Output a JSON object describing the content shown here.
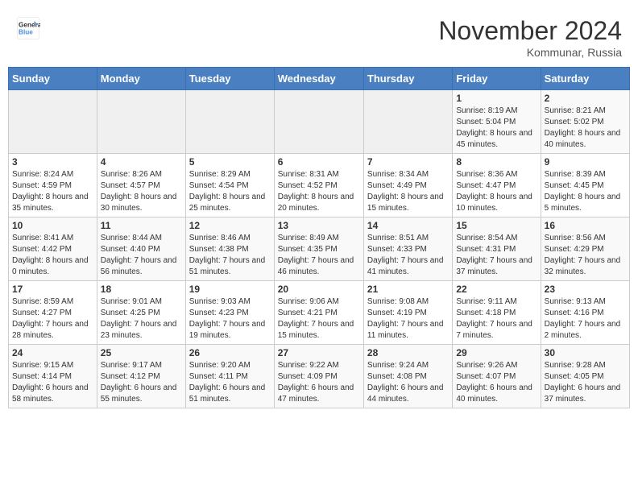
{
  "logo": {
    "line1": "General",
    "line2": "Blue"
  },
  "title": "November 2024",
  "location": "Kommunar, Russia",
  "weekdays": [
    "Sunday",
    "Monday",
    "Tuesday",
    "Wednesday",
    "Thursday",
    "Friday",
    "Saturday"
  ],
  "weeks": [
    [
      {
        "day": "",
        "info": ""
      },
      {
        "day": "",
        "info": ""
      },
      {
        "day": "",
        "info": ""
      },
      {
        "day": "",
        "info": ""
      },
      {
        "day": "",
        "info": ""
      },
      {
        "day": "1",
        "info": "Sunrise: 8:19 AM\nSunset: 5:04 PM\nDaylight: 8 hours and 45 minutes."
      },
      {
        "day": "2",
        "info": "Sunrise: 8:21 AM\nSunset: 5:02 PM\nDaylight: 8 hours and 40 minutes."
      }
    ],
    [
      {
        "day": "3",
        "info": "Sunrise: 8:24 AM\nSunset: 4:59 PM\nDaylight: 8 hours and 35 minutes."
      },
      {
        "day": "4",
        "info": "Sunrise: 8:26 AM\nSunset: 4:57 PM\nDaylight: 8 hours and 30 minutes."
      },
      {
        "day": "5",
        "info": "Sunrise: 8:29 AM\nSunset: 4:54 PM\nDaylight: 8 hours and 25 minutes."
      },
      {
        "day": "6",
        "info": "Sunrise: 8:31 AM\nSunset: 4:52 PM\nDaylight: 8 hours and 20 minutes."
      },
      {
        "day": "7",
        "info": "Sunrise: 8:34 AM\nSunset: 4:49 PM\nDaylight: 8 hours and 15 minutes."
      },
      {
        "day": "8",
        "info": "Sunrise: 8:36 AM\nSunset: 4:47 PM\nDaylight: 8 hours and 10 minutes."
      },
      {
        "day": "9",
        "info": "Sunrise: 8:39 AM\nSunset: 4:45 PM\nDaylight: 8 hours and 5 minutes."
      }
    ],
    [
      {
        "day": "10",
        "info": "Sunrise: 8:41 AM\nSunset: 4:42 PM\nDaylight: 8 hours and 0 minutes."
      },
      {
        "day": "11",
        "info": "Sunrise: 8:44 AM\nSunset: 4:40 PM\nDaylight: 7 hours and 56 minutes."
      },
      {
        "day": "12",
        "info": "Sunrise: 8:46 AM\nSunset: 4:38 PM\nDaylight: 7 hours and 51 minutes."
      },
      {
        "day": "13",
        "info": "Sunrise: 8:49 AM\nSunset: 4:35 PM\nDaylight: 7 hours and 46 minutes."
      },
      {
        "day": "14",
        "info": "Sunrise: 8:51 AM\nSunset: 4:33 PM\nDaylight: 7 hours and 41 minutes."
      },
      {
        "day": "15",
        "info": "Sunrise: 8:54 AM\nSunset: 4:31 PM\nDaylight: 7 hours and 37 minutes."
      },
      {
        "day": "16",
        "info": "Sunrise: 8:56 AM\nSunset: 4:29 PM\nDaylight: 7 hours and 32 minutes."
      }
    ],
    [
      {
        "day": "17",
        "info": "Sunrise: 8:59 AM\nSunset: 4:27 PM\nDaylight: 7 hours and 28 minutes."
      },
      {
        "day": "18",
        "info": "Sunrise: 9:01 AM\nSunset: 4:25 PM\nDaylight: 7 hours and 23 minutes."
      },
      {
        "day": "19",
        "info": "Sunrise: 9:03 AM\nSunset: 4:23 PM\nDaylight: 7 hours and 19 minutes."
      },
      {
        "day": "20",
        "info": "Sunrise: 9:06 AM\nSunset: 4:21 PM\nDaylight: 7 hours and 15 minutes."
      },
      {
        "day": "21",
        "info": "Sunrise: 9:08 AM\nSunset: 4:19 PM\nDaylight: 7 hours and 11 minutes."
      },
      {
        "day": "22",
        "info": "Sunrise: 9:11 AM\nSunset: 4:18 PM\nDaylight: 7 hours and 7 minutes."
      },
      {
        "day": "23",
        "info": "Sunrise: 9:13 AM\nSunset: 4:16 PM\nDaylight: 7 hours and 2 minutes."
      }
    ],
    [
      {
        "day": "24",
        "info": "Sunrise: 9:15 AM\nSunset: 4:14 PM\nDaylight: 6 hours and 58 minutes."
      },
      {
        "day": "25",
        "info": "Sunrise: 9:17 AM\nSunset: 4:12 PM\nDaylight: 6 hours and 55 minutes."
      },
      {
        "day": "26",
        "info": "Sunrise: 9:20 AM\nSunset: 4:11 PM\nDaylight: 6 hours and 51 minutes."
      },
      {
        "day": "27",
        "info": "Sunrise: 9:22 AM\nSunset: 4:09 PM\nDaylight: 6 hours and 47 minutes."
      },
      {
        "day": "28",
        "info": "Sunrise: 9:24 AM\nSunset: 4:08 PM\nDaylight: 6 hours and 44 minutes."
      },
      {
        "day": "29",
        "info": "Sunrise: 9:26 AM\nSunset: 4:07 PM\nDaylight: 6 hours and 40 minutes."
      },
      {
        "day": "30",
        "info": "Sunrise: 9:28 AM\nSunset: 4:05 PM\nDaylight: 6 hours and 37 minutes."
      }
    ]
  ]
}
